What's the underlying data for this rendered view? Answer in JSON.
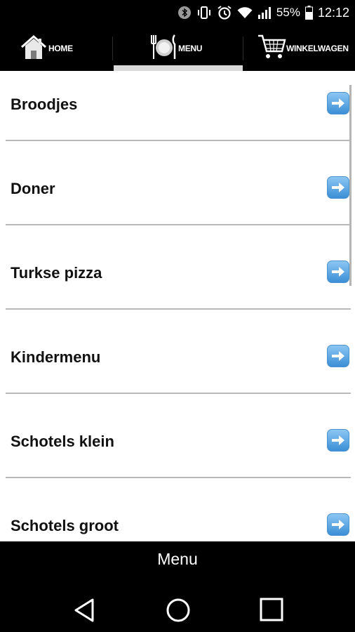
{
  "status_bar": {
    "battery_percent": "55%",
    "time": "12:12",
    "icons": [
      "bluetooth-icon",
      "vibrate-icon",
      "alarm-icon",
      "wifi-icon",
      "signal-icon",
      "battery-icon"
    ]
  },
  "tabs": [
    {
      "label": "HOME",
      "icon": "home-icon"
    },
    {
      "label": "MENU",
      "icon": "plate-cutlery-icon",
      "active": true
    },
    {
      "label": "WINKELWAGEN",
      "icon": "shopping-cart-icon"
    }
  ],
  "menu_items": [
    {
      "label": "Broodjes"
    },
    {
      "label": "Doner"
    },
    {
      "label": "Turkse pizza"
    },
    {
      "label": "Kindermenu"
    },
    {
      "label": "Schotels klein"
    },
    {
      "label": "Schotels groot"
    }
  ],
  "bottom_bar": {
    "title": "Menu"
  },
  "colors": {
    "accent_arrow": "#3b8fd6",
    "tab_indicator": "#d9d9d9",
    "divider": "#b9b9b9"
  }
}
